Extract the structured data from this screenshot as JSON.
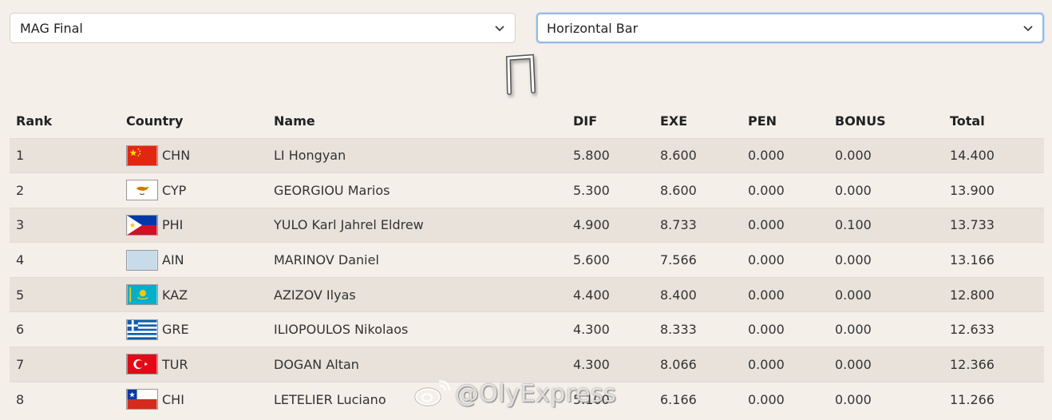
{
  "filters": {
    "competition": "MAG Final",
    "apparatus": "Horizontal Bar"
  },
  "apparatus_icon": "horizontal-bar-icon",
  "table": {
    "headers": {
      "rank": "Rank",
      "country": "Country",
      "name": "Name",
      "dif": "DIF",
      "exe": "EXE",
      "pen": "PEN",
      "bonus": "BONUS",
      "total": "Total"
    },
    "rows": [
      {
        "rank": "1",
        "flag": "china-flag",
        "country": "CHN",
        "name": "LI Hongyan",
        "dif": "5.800",
        "exe": "8.600",
        "pen": "0.000",
        "bonus": "0.000",
        "total": "14.400"
      },
      {
        "rank": "2",
        "flag": "cyprus-flag",
        "country": "CYP",
        "name": "GEORGIOU Marios",
        "dif": "5.300",
        "exe": "8.600",
        "pen": "0.000",
        "bonus": "0.000",
        "total": "13.900"
      },
      {
        "rank": "3",
        "flag": "philippines-flag",
        "country": "PHI",
        "name": "YULO Karl Jahrel Eldrew",
        "dif": "4.900",
        "exe": "8.733",
        "pen": "0.000",
        "bonus": "0.100",
        "total": "13.733"
      },
      {
        "rank": "4",
        "flag": "ain-flag",
        "country": "AIN",
        "name": "MARINOV Daniel",
        "dif": "5.600",
        "exe": "7.566",
        "pen": "0.000",
        "bonus": "0.000",
        "total": "13.166"
      },
      {
        "rank": "5",
        "flag": "kazakhstan-flag",
        "country": "KAZ",
        "name": "AZIZOV Ilyas",
        "dif": "4.400",
        "exe": "8.400",
        "pen": "0.000",
        "bonus": "0.000",
        "total": "12.800"
      },
      {
        "rank": "6",
        "flag": "greece-flag",
        "country": "GRE",
        "name": "ILIOPOULOS Nikolaos",
        "dif": "4.300",
        "exe": "8.333",
        "pen": "0.000",
        "bonus": "0.000",
        "total": "12.633"
      },
      {
        "rank": "7",
        "flag": "turkey-flag",
        "country": "TUR",
        "name": "DOGAN Altan",
        "dif": "4.300",
        "exe": "8.066",
        "pen": "0.000",
        "bonus": "0.000",
        "total": "12.366"
      },
      {
        "rank": "8",
        "flag": "chile-flag",
        "country": "CHI",
        "name": "LETELIER Luciano",
        "dif": "5.100",
        "exe": "6.166",
        "pen": "0.000",
        "bonus": "0.000",
        "total": "11.266"
      }
    ]
  },
  "watermark": {
    "text": "@OlyExpress",
    "logo": "weibo-logo-icon"
  },
  "colors": {
    "page_bg": "#f4efe9",
    "row_stripe": "#e8e2db",
    "focus_border": "#9ab8e6"
  }
}
